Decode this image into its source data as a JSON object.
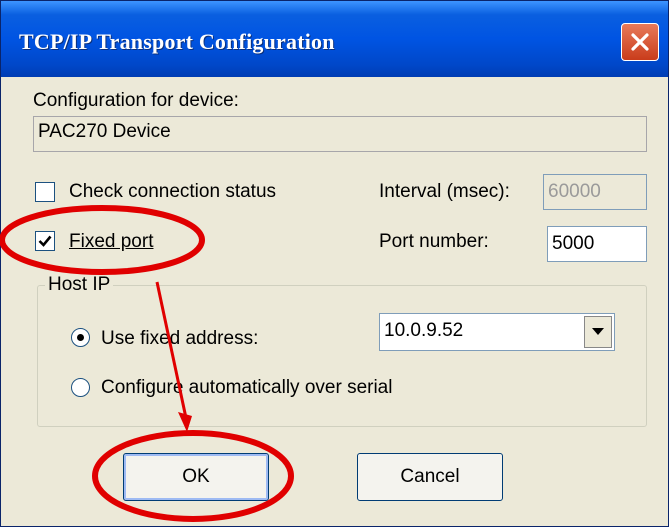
{
  "window": {
    "title": "TCP/IP Transport Configuration"
  },
  "device": {
    "caption": "Configuration for device:",
    "name": "PAC270 Device"
  },
  "check_status": {
    "label": "Check connection status",
    "checked": false
  },
  "interval": {
    "label": "Interval (msec):",
    "value": "60000"
  },
  "fixed_port": {
    "label": "Fixed port",
    "checked": true
  },
  "port_number": {
    "label": "Port number:",
    "value": "5000"
  },
  "host_ip": {
    "group_label": "Host IP",
    "use_fixed": {
      "label": "Use fixed address:",
      "selected": true
    },
    "address": "10.0.9.52",
    "auto_serial": {
      "label": "Configure automatically over serial",
      "selected": false
    }
  },
  "buttons": {
    "ok": "OK",
    "cancel": "Cancel"
  },
  "annotation": {
    "color": "#e00000"
  }
}
